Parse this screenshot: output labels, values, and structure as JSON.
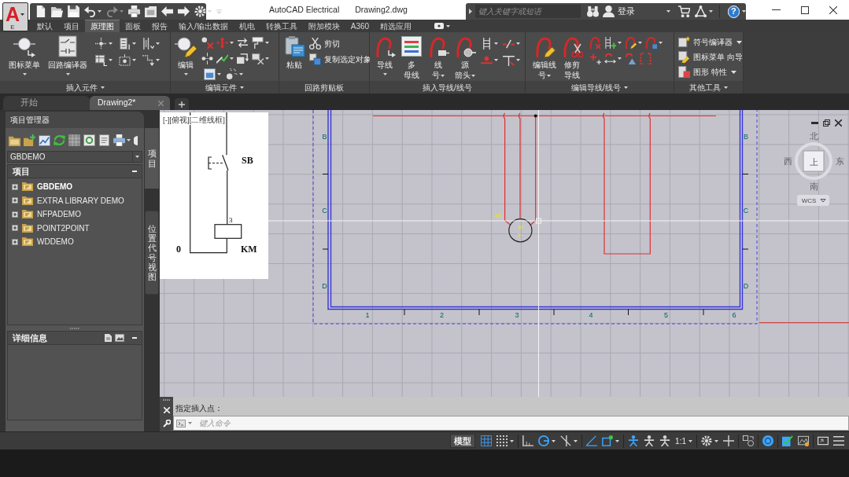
{
  "app_button": {
    "logo": "A",
    "edition": "E"
  },
  "title_bar": {
    "app_name": "AutoCAD Electrical",
    "document": "Drawing2.dwg"
  },
  "info_center": {
    "search": {
      "placeholder": "键入关键字或短语"
    },
    "sign_in": "登录",
    "help": "?"
  },
  "ribbon_tabs": [
    {
      "label": "默认",
      "selected": false
    },
    {
      "label": "项目",
      "selected": false
    },
    {
      "label": "原理图",
      "selected": true
    },
    {
      "label": "面板",
      "selected": false
    },
    {
      "label": "报告",
      "selected": false
    },
    {
      "label": "输入/输出数据",
      "selected": false
    },
    {
      "label": "机电",
      "selected": false
    },
    {
      "label": "转换工具",
      "selected": false
    },
    {
      "label": "附加模块",
      "selected": false
    },
    {
      "label": "A360",
      "selected": false
    },
    {
      "label": "精选应用",
      "selected": false
    }
  ],
  "ribbon_panels": [
    {
      "title": "插入元件",
      "menu": true,
      "buttons": [
        {
          "label": "图标菜单",
          "dropdown": true
        },
        {
          "label": "回路编译器",
          "dropdown": true
        }
      ]
    },
    {
      "title": "编辑元件",
      "menu": true,
      "buttons": [
        {
          "label": "编辑",
          "dropdown": true
        }
      ]
    },
    {
      "title": "回路剪贴板",
      "menu": false,
      "buttons": [
        {
          "label": "粘贴",
          "dropdown": false
        }
      ],
      "small_buttons": [
        {
          "label": "剪切"
        },
        {
          "label": "复制选定对象"
        }
      ]
    },
    {
      "title": "插入导线/线号",
      "menu": false,
      "buttons": [
        {
          "label": "导线",
          "dropdown": true
        },
        {
          "label": "多母线",
          "dropdown": false
        },
        {
          "label": "线号",
          "dropdown": true
        },
        {
          "label": "源箭头",
          "dropdown": true
        }
      ]
    },
    {
      "title": "编辑导线/线号",
      "menu": true,
      "buttons": [
        {
          "label": "编辑线号",
          "dropdown": true
        },
        {
          "label": "修剪导线",
          "dropdown": false
        }
      ]
    },
    {
      "title": "其他工具",
      "menu": true,
      "small_buttons": [
        {
          "label": "符号编译器",
          "dropdown": true
        },
        {
          "label": "图标菜单 向导",
          "dropdown": false
        },
        {
          "label": "图形 特性",
          "dropdown": true
        }
      ]
    }
  ],
  "document_tabs": [
    {
      "label": "开始",
      "selected": false,
      "closable": false
    },
    {
      "label": "Drawing2*",
      "selected": true,
      "closable": true
    }
  ],
  "project_manager": {
    "title": "项目管理器",
    "project": "GBDEMO",
    "tree_header": "项目",
    "projects": [
      {
        "label": "GBDEMO",
        "active": true,
        "expanded": false
      },
      {
        "label": "EXTRA LIBRARY DEMO",
        "active": false,
        "expanded": false
      },
      {
        "label": "NFPADEMO",
        "active": false,
        "expanded": false
      },
      {
        "label": "POINT2POINT",
        "active": false,
        "expanded": false
      },
      {
        "label": "WDDEMO",
        "active": false,
        "expanded": false
      }
    ],
    "details_header": "详细信息"
  },
  "side_tabs": [
    {
      "label": "项目",
      "selected": true
    },
    {
      "label": "位置代号视图",
      "selected": false
    }
  ],
  "canvas": {
    "viewport_label": "[-][俯视][二维线框]",
    "reference_diagram": {
      "switch_label": "SB",
      "terminal_label": "3",
      "coil_label": "KM",
      "wire_label": "0"
    },
    "zone_rows_left": [
      "B",
      "C",
      "D"
    ],
    "zone_rows_right": [
      "B",
      "C",
      "D"
    ],
    "zone_columns": [
      "1",
      "2",
      "3",
      "4",
      "5",
      "6"
    ],
    "motor": {
      "tag": "-M1",
      "symbol": "M",
      "phases": "3~"
    },
    "viewcube": {
      "north": "北",
      "west": "西",
      "east": "东",
      "south": "南",
      "face": "上",
      "coordinate_system": "WCS"
    }
  },
  "command_line": {
    "history": "指定插入点：",
    "placeholder": "键入命令"
  },
  "status_bar": {
    "space": "模型",
    "toggles": [
      {
        "kind": "grid",
        "on": true,
        "menu": false
      },
      {
        "kind": "snap",
        "on": false,
        "menu": true
      },
      {
        "kind": "ortho",
        "on": false,
        "menu": false
      },
      {
        "kind": "polar",
        "on": true,
        "menu": true
      },
      {
        "kind": "isodraft",
        "on": false,
        "menu": true
      },
      {
        "kind": "tracking",
        "on": true,
        "menu": false
      },
      {
        "kind": "osnap",
        "on": true,
        "menu": true
      },
      {
        "kind": "annotation",
        "on": true,
        "menu": false
      },
      {
        "kind": "visibility",
        "on": false,
        "menu": false
      },
      {
        "kind": "autoscale",
        "on": false,
        "menu": false
      }
    ],
    "annotation_scale": "1:1",
    "tools": [
      {
        "kind": "workspace",
        "on": false,
        "menu": true
      },
      {
        "kind": "units",
        "on": false,
        "menu": false
      },
      {
        "kind": "isolate",
        "on": false,
        "menu": false
      },
      {
        "kind": "hardware",
        "on": true,
        "menu": false
      },
      {
        "kind": "quickprops",
        "on": true,
        "menu": false
      },
      {
        "kind": "performance",
        "on": false,
        "menu": false
      },
      {
        "kind": "fullscreen",
        "on": false,
        "menu": false
      },
      {
        "kind": "customize",
        "on": false,
        "menu": false
      }
    ]
  }
}
